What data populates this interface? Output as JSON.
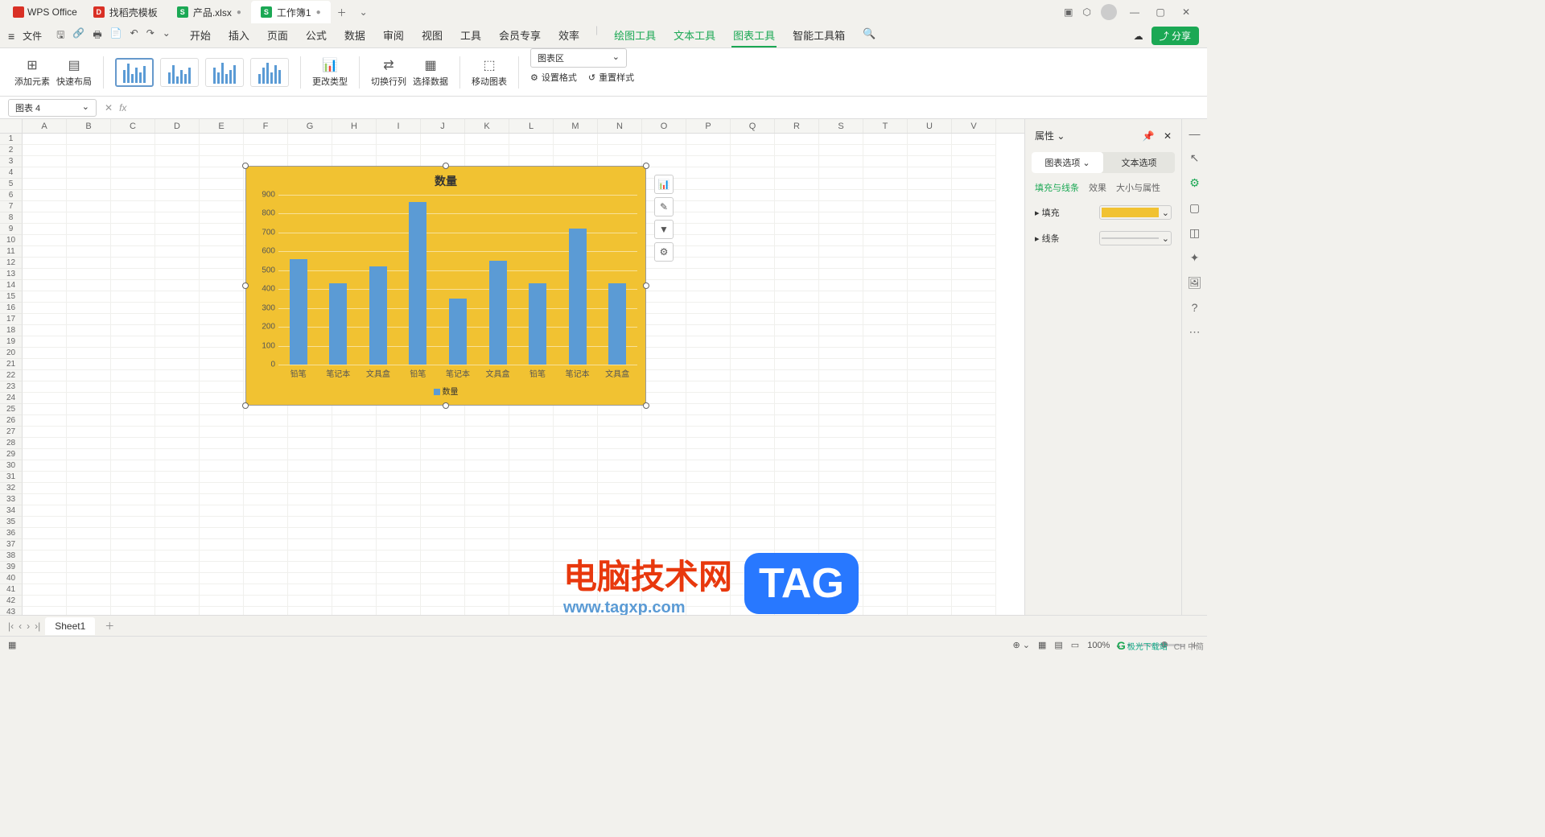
{
  "titlebar": {
    "app_name": "WPS Office",
    "tabs": [
      {
        "label": "找稻壳模板",
        "icon": "red"
      },
      {
        "label": "产品.xlsx",
        "icon": "green"
      },
      {
        "label": "工作簿1",
        "icon": "green",
        "active": true
      }
    ]
  },
  "menubar": {
    "file": "文件",
    "tabs": [
      "开始",
      "插入",
      "页面",
      "公式",
      "数据",
      "审阅",
      "视图",
      "工具",
      "会员专享",
      "效率"
    ],
    "tool_tabs": [
      "绘图工具",
      "文本工具",
      "图表工具",
      "智能工具箱"
    ],
    "active_tool": "图表工具",
    "share": "分享"
  },
  "ribbon": {
    "add_element": "添加元素",
    "quick_layout": "快速布局",
    "change_type": "更改类型",
    "switch_rowcol": "切换行列",
    "select_data": "选择数据",
    "move_chart": "移动图表",
    "chart_area_label": "图表区",
    "set_format": "设置格式",
    "reset_style": "重置样式"
  },
  "name_box": "图表 4",
  "columns": [
    "A",
    "B",
    "C",
    "D",
    "E",
    "F",
    "G",
    "H",
    "I",
    "J",
    "K",
    "L",
    "M",
    "N",
    "O",
    "P",
    "Q",
    "R",
    "S",
    "T",
    "U",
    "V"
  ],
  "side_panel": {
    "title": "属性",
    "tab1": "图表选项",
    "tab2": "文本选项",
    "sub1": "填充与线条",
    "sub2": "效果",
    "sub3": "大小与属性",
    "fill_label": "填充",
    "line_label": "线条"
  },
  "sheet": {
    "name": "Sheet1"
  },
  "status": {
    "zoom": "100%"
  },
  "watermark": {
    "line1": "电脑技术网",
    "line2": "www.tagxp.com",
    "tag": "TAG"
  },
  "footer": {
    "brand": "极光下载站",
    "chs": "CH 中简"
  },
  "chart_data": {
    "type": "bar",
    "title": "数量",
    "legend": "数量",
    "categories": [
      "铅笔",
      "笔记本",
      "文具盒",
      "铅笔",
      "笔记本",
      "文具盒",
      "铅笔",
      "笔记本",
      "文具盒"
    ],
    "values": [
      560,
      430,
      520,
      860,
      350,
      550,
      430,
      720,
      430
    ],
    "ylim": [
      0,
      900
    ],
    "yticks": [
      0,
      100,
      200,
      300,
      400,
      500,
      600,
      700,
      800,
      900
    ],
    "xlabel": "",
    "ylabel": ""
  }
}
